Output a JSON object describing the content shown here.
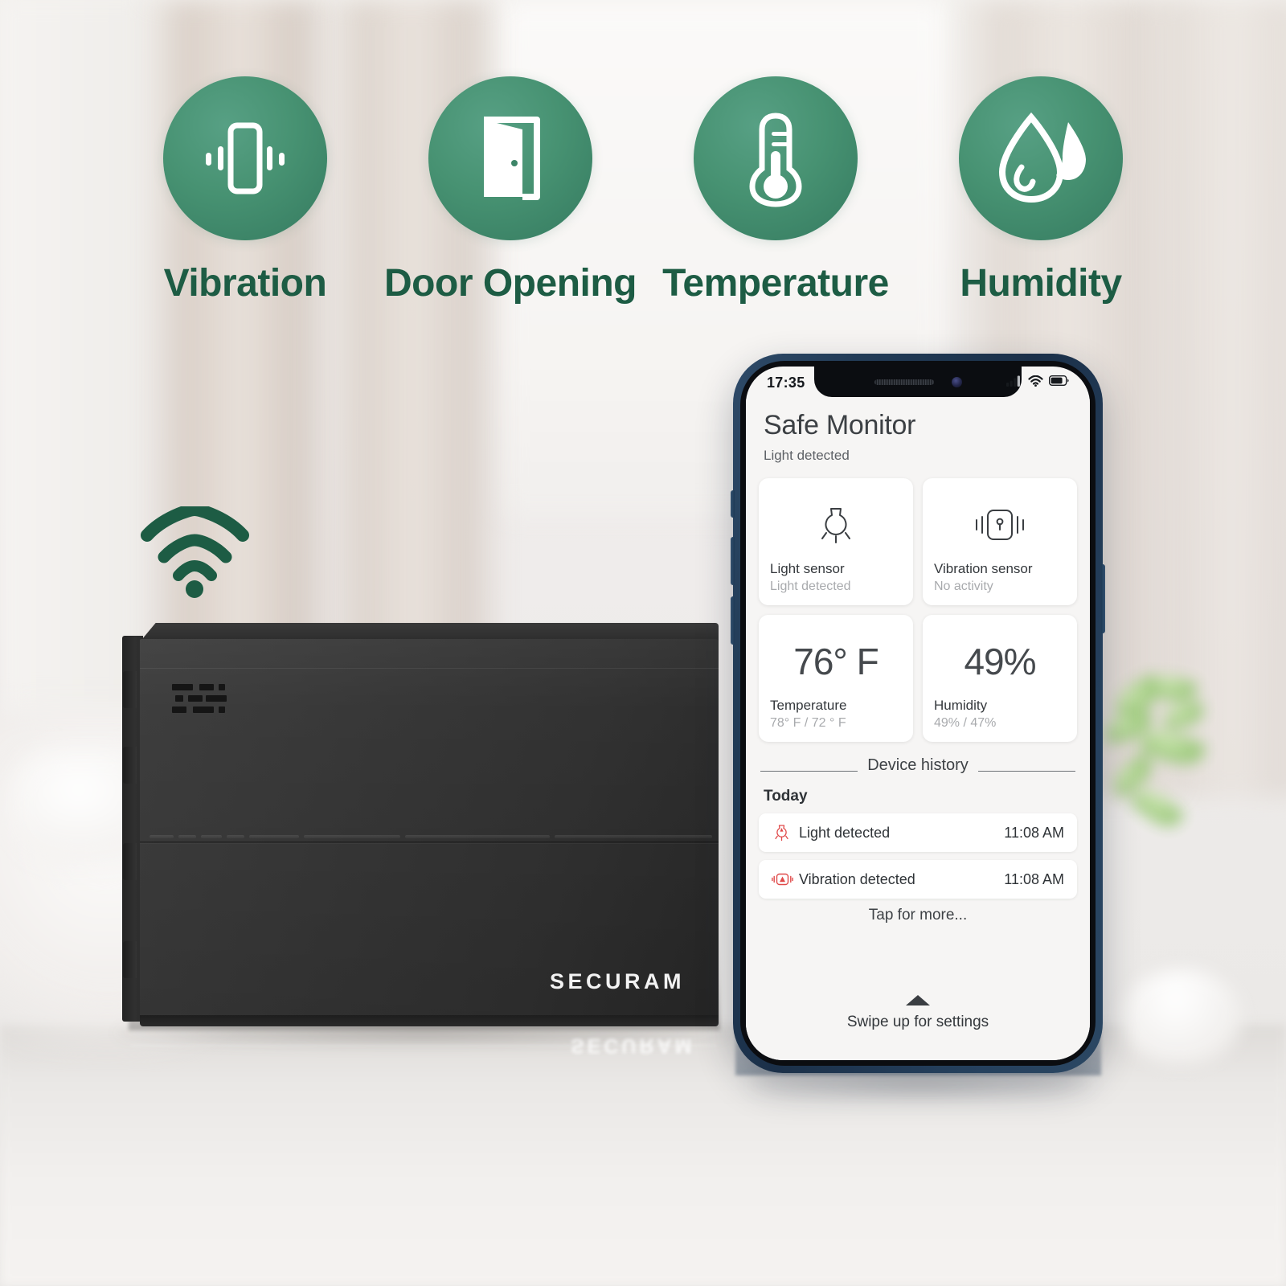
{
  "scene": {
    "brand": "SECURAM",
    "brand_reflection": "SECURAM"
  },
  "features": [
    {
      "label": "Vibration",
      "icon": "vibration-icon"
    },
    {
      "label": "Door Opening",
      "icon": "door-opening-icon"
    },
    {
      "label": "Temperature",
      "icon": "thermometer-icon"
    },
    {
      "label": "Humidity",
      "icon": "water-droplet-icon"
    }
  ],
  "colors": {
    "accent_green": "#3d8568",
    "label_green": "#1d5c44",
    "alert_red": "#e04a4a",
    "phone_frame": "#1b3049"
  },
  "phone": {
    "statusbar": {
      "time": "17:35",
      "signal_icon": "cellular-signal-icon",
      "wifi_icon": "wifi-icon",
      "battery_icon": "battery-icon"
    },
    "app": {
      "title": "Safe Monitor",
      "subtitle": "Light detected",
      "cards": [
        {
          "icon": "light-bulb-icon",
          "name": "Light sensor",
          "status": "Light detected"
        },
        {
          "icon": "safe-vibration-icon",
          "name": "Vibration sensor",
          "status": "No activity"
        }
      ],
      "metrics": [
        {
          "value": "76° F",
          "name": "Temperature",
          "status": "78° F / 72 ° F"
        },
        {
          "value": "49%",
          "name": "Humidity",
          "status": "49% / 47%"
        }
      ],
      "history": {
        "divider_label": "Device history",
        "group_label": "Today",
        "rows": [
          {
            "icon": "light-alert-icon",
            "text": "Light detected",
            "time": "11:08 AM"
          },
          {
            "icon": "vibration-alert-icon",
            "text": "Vibration detected",
            "time": "11:08 AM"
          }
        ],
        "more_label": "Tap for more..."
      },
      "swipe": {
        "arrow_icon": "chevron-up-icon",
        "label": "Swipe up for settings"
      }
    }
  }
}
